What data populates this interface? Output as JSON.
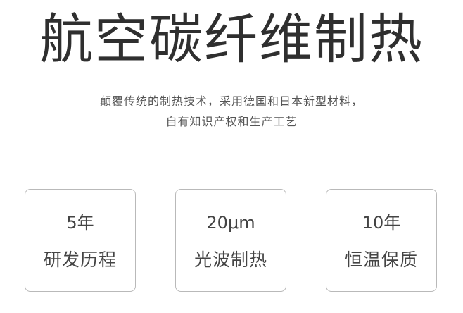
{
  "headline": "航空碳纤维制热",
  "description": {
    "line1": "颠覆传统的制热技术，采用德国和日本新型材料，",
    "line2": "自有知识产权和生产工艺"
  },
  "features": [
    {
      "value": "5年",
      "label": "研发历程"
    },
    {
      "value": "20μm",
      "label": "光波制热"
    },
    {
      "value": "10年",
      "label": "恒温保质"
    }
  ],
  "colors": {
    "text": "#333333",
    "border": "#b9b9b9",
    "background": "#ffffff"
  }
}
